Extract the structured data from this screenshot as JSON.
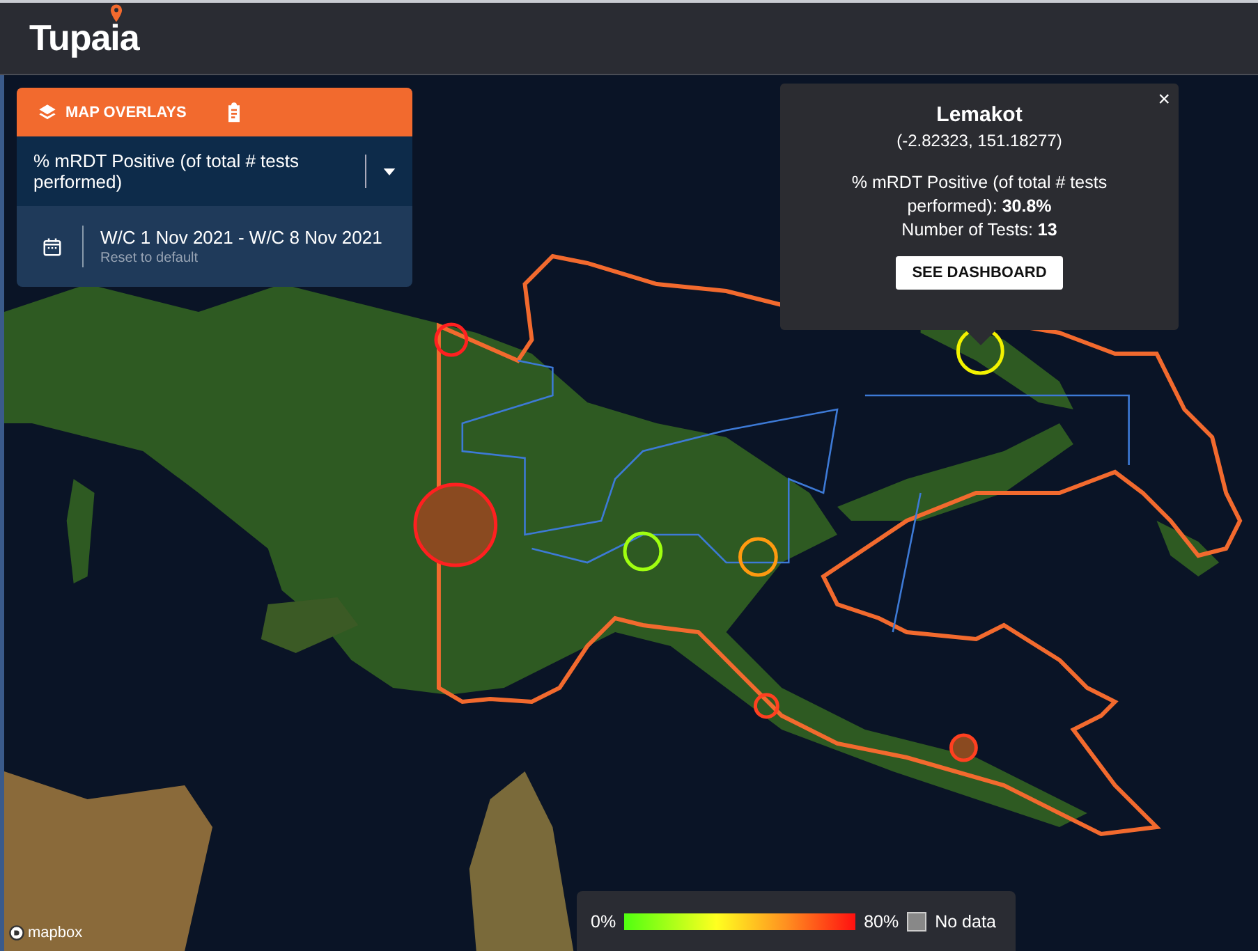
{
  "header": {
    "logo": "Tupaia"
  },
  "overlay_panel": {
    "title": "MAP OVERLAYS",
    "selected_overlay": "% mRDT Positive (of total # tests performed)",
    "date_range": "W/C 1 Nov 2021 - W/C 8 Nov 2021",
    "reset_link": "Reset to default"
  },
  "map": {
    "markers": [
      {
        "color": "#ff2020",
        "filled": false
      },
      {
        "color": "#ff2020",
        "filled": true
      },
      {
        "color": "#f2f200",
        "filled": false
      },
      {
        "color": "#a0ff10",
        "filled": false
      },
      {
        "color": "#ff9a10",
        "filled": false
      },
      {
        "color": "#ff4020",
        "filled": false
      },
      {
        "color": "#ff4020",
        "filled": true
      }
    ],
    "attribution": "mapbox"
  },
  "popup": {
    "title": "Lemakot",
    "coordinates": "(-2.82323, 151.18277)",
    "lines": [
      "% mRDT Positive (of total # tests performed): **30.8%**",
      "Number of Tests: **13**"
    ],
    "button": "SEE DASHBOARD",
    "close": "×"
  },
  "legend": {
    "min_label": "0%",
    "max_label": "80%",
    "no_data_label": "No data"
  }
}
